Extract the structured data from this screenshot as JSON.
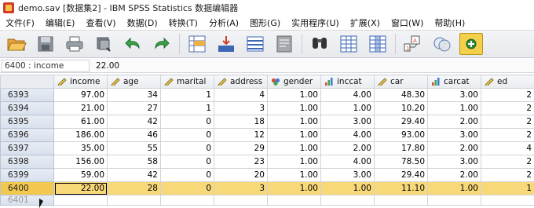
{
  "window": {
    "title": "demo.sav [数据集2] - IBM SPSS Statistics 数据编辑器"
  },
  "menu": [
    {
      "label": "文件(F)"
    },
    {
      "label": "编辑(E)"
    },
    {
      "label": "查看(V)"
    },
    {
      "label": "数据(D)"
    },
    {
      "label": "转换(T)"
    },
    {
      "label": "分析(A)"
    },
    {
      "label": "图形(G)"
    },
    {
      "label": "实用程序(U)"
    },
    {
      "label": "扩展(X)"
    },
    {
      "label": "窗口(W)"
    },
    {
      "label": "帮助(H)"
    }
  ],
  "toolbar": {
    "buttons": [
      {
        "icon": "open-folder-icon"
      },
      {
        "icon": "save-icon"
      },
      {
        "icon": "print-icon"
      },
      {
        "icon": "dialog-recall-icon"
      },
      {
        "icon": "undo-icon"
      },
      {
        "icon": "redo-icon"
      },
      {
        "icon": "goto-case-icon"
      },
      {
        "icon": "goto-variable-icon"
      },
      {
        "icon": "variables-icon"
      },
      {
        "icon": "run-descriptives-icon"
      },
      {
        "icon": "find-icon"
      },
      {
        "icon": "insert-cases-icon"
      },
      {
        "icon": "insert-variable-icon"
      },
      {
        "icon": "split-file-icon"
      },
      {
        "icon": "weight-cases-icon"
      },
      {
        "icon": "select-cases-icon"
      },
      {
        "icon": "value-labels-icon"
      }
    ]
  },
  "cell_editor": {
    "reference": "6400 : income",
    "value": "22.00"
  },
  "grid": {
    "columns": [
      {
        "name": "income",
        "type": "scale"
      },
      {
        "name": "age",
        "type": "scale"
      },
      {
        "name": "marital",
        "type": "scale"
      },
      {
        "name": "address",
        "type": "scale"
      },
      {
        "name": "gender",
        "type": "nominal"
      },
      {
        "name": "inccat",
        "type": "ordinal"
      },
      {
        "name": "car",
        "type": "scale"
      },
      {
        "name": "carcat",
        "type": "ordinal"
      },
      {
        "name": "ed",
        "type": "scale"
      }
    ],
    "rows": [
      {
        "id": "6393",
        "cells": [
          "97.00",
          "34",
          "1",
          "4",
          "1.00",
          "4.00",
          "48.30",
          "3.00",
          "2"
        ]
      },
      {
        "id": "6394",
        "cells": [
          "21.00",
          "27",
          "1",
          "3",
          "1.00",
          "1.00",
          "10.20",
          "1.00",
          "2"
        ]
      },
      {
        "id": "6395",
        "cells": [
          "61.00",
          "42",
          "0",
          "18",
          "1.00",
          "3.00",
          "29.40",
          "2.00",
          "2"
        ]
      },
      {
        "id": "6396",
        "cells": [
          "186.00",
          "46",
          "0",
          "12",
          "1.00",
          "4.00",
          "93.00",
          "3.00",
          "2"
        ]
      },
      {
        "id": "6397",
        "cells": [
          "35.00",
          "55",
          "0",
          "29",
          "1.00",
          "2.00",
          "17.80",
          "2.00",
          "4"
        ]
      },
      {
        "id": "6398",
        "cells": [
          "156.00",
          "58",
          "0",
          "23",
          "1.00",
          "4.00",
          "78.50",
          "3.00",
          "2"
        ]
      },
      {
        "id": "6399",
        "cells": [
          "59.00",
          "42",
          "0",
          "20",
          "1.00",
          "3.00",
          "29.40",
          "2.00",
          "2"
        ]
      },
      {
        "id": "6400",
        "cells": [
          "22.00",
          "28",
          "0",
          "3",
          "1.00",
          "1.00",
          "11.10",
          "1.00",
          "1"
        ],
        "selected": true
      },
      {
        "id": "6401",
        "cells": [
          "",
          "",
          "",
          "",
          "",
          "",
          "",
          "",
          ""
        ],
        "ghost": true
      }
    ]
  },
  "colors": {
    "selected_row": "#f8d97a",
    "selected_header": "#f2c84f",
    "row_header": "#d8e0ec"
  }
}
